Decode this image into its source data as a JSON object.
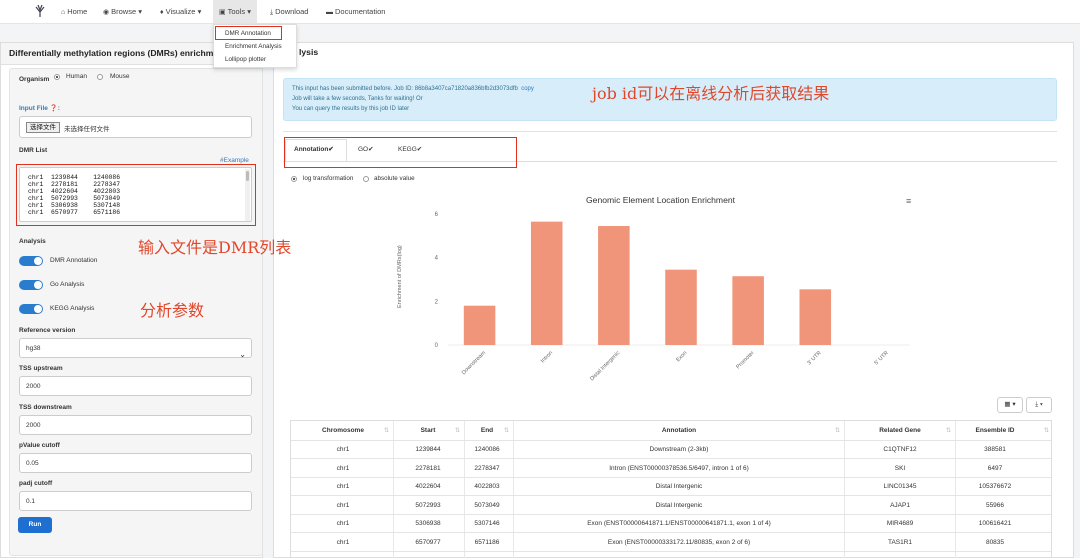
{
  "navbar": {
    "items": [
      {
        "label": "Home",
        "icon": "home-icon",
        "glyph": "⌂"
      },
      {
        "label": "Browse",
        "icon": "eye-icon",
        "glyph": "◉",
        "caret": "▾"
      },
      {
        "label": "Visualize",
        "icon": "pin-icon",
        "glyph": "♦",
        "caret": "▾"
      },
      {
        "label": "Tools",
        "icon": "briefcase-icon",
        "glyph": "▣",
        "caret": "▾"
      },
      {
        "label": "Download",
        "icon": "download-icon",
        "glyph": "⤓"
      },
      {
        "label": "Documentation",
        "icon": "folder-icon",
        "glyph": "▬"
      }
    ],
    "tools_menu": [
      "DMR Annotation",
      "Enrichment Analysis",
      "Lollipop plotter"
    ]
  },
  "left_panel": {
    "title": "Differentially methylation regions (DMRs) enrichm",
    "organism_label": "Organism",
    "organism_options": [
      "Human",
      "Mouse"
    ],
    "organism_selected": "Human",
    "input_file_label": "Input File",
    "file_button": "选择文件",
    "file_status": "未选择任何文件",
    "dmr_list_label": "DMR List",
    "example_link": "#Example",
    "dmr_rows": [
      [
        "chr1",
        "1239844",
        "1240086"
      ],
      [
        "chr1",
        "2278181",
        "2278347"
      ],
      [
        "chr1",
        "4022604",
        "4022803"
      ],
      [
        "chr1",
        "5072993",
        "5073049"
      ],
      [
        "chr1",
        "5306938",
        "5307148"
      ],
      [
        "chr1",
        "6570977",
        "6571186"
      ]
    ],
    "analysis_label": "Analysis",
    "toggles": [
      {
        "label": "DMR Annotation",
        "on": true
      },
      {
        "label": "Go Analysis",
        "on": true
      },
      {
        "label": "KEGG Analysis",
        "on": true
      }
    ],
    "reference_label": "Reference version",
    "reference_value": "hg38",
    "tss_upstream_label": "TSS upstream",
    "tss_upstream_value": "2000",
    "tss_downstream_label": "TSS downstream",
    "tss_downstream_value": "2000",
    "pvalue_label": "pValue cutoff",
    "pvalue_value": "0.05",
    "padj_label": "padj cutoff",
    "padj_value": "0.1",
    "run_button": "Run"
  },
  "annotations": {
    "job_id_note": "job id可以在离线分析后获取结果",
    "input_note": "输入文件是DMR列表",
    "params_note": "分析参数"
  },
  "right_panel": {
    "title_tail": "lysis",
    "alert_lines": [
      "This input has been submitted before. Job ID: 86b8a3407ca71820a836bfb2d3073dfb",
      "Job will take a few seconds, Tanks for waiting! Or",
      "You can query the results by this job ID later"
    ],
    "alert_copy": "copy",
    "tabs": [
      "Annotation",
      "GO",
      "KEGG"
    ],
    "tab_check": "✔",
    "active_tab": "Annotation",
    "view_options": [
      "log transformation",
      "absolute value"
    ],
    "view_selected": "log transformation",
    "menu_glyph": "≡",
    "table_tools": [
      "▦ ▾",
      "⤓ ▾"
    ],
    "sort_glyph": "⇅"
  },
  "chart_data": {
    "type": "bar",
    "title": "Genomic Element Location Enrichment",
    "xlabel": "",
    "ylabel": "Enrichment of DMRs(log)",
    "categories": [
      "Downstream",
      "Intron",
      "Distal Intergenic",
      "Exon",
      "Promoter",
      "3' UTR",
      "5' UTR"
    ],
    "values": [
      1.8,
      5.65,
      5.45,
      3.45,
      3.15,
      2.55,
      0
    ],
    "ylim": [
      0,
      6
    ],
    "yticks": [
      0,
      2,
      4,
      6
    ],
    "bar_color": "#f0957a",
    "grid": false
  },
  "table": {
    "columns": [
      "Chromosome",
      "Start",
      "End",
      "Annotation",
      "Related Gene",
      "Ensemble ID"
    ],
    "rows": [
      [
        "chr1",
        "1239844",
        "1240086",
        "Downstream (2-3kb)",
        "C1QTNF12",
        "388581"
      ],
      [
        "chr1",
        "2278181",
        "2278347",
        "Intron (ENST00000378536.5/6497, intron 1 of 6)",
        "SKI",
        "6497"
      ],
      [
        "chr1",
        "4022604",
        "4022803",
        "Distal Intergenic",
        "LINC01345",
        "105376672"
      ],
      [
        "chr1",
        "5072993",
        "5073049",
        "Distal Intergenic",
        "AJAP1",
        "55966"
      ],
      [
        "chr1",
        "5306938",
        "5307146",
        "Exon (ENST00000641871.1/ENST00000641871.1, exon 1 of 4)",
        "MIR4689",
        "100616421"
      ],
      [
        "chr1",
        "6570977",
        "6571186",
        "Exon (ENST00000333172.11/80835, exon 2 of 6)",
        "TAS1R1",
        "80835"
      ]
    ]
  }
}
